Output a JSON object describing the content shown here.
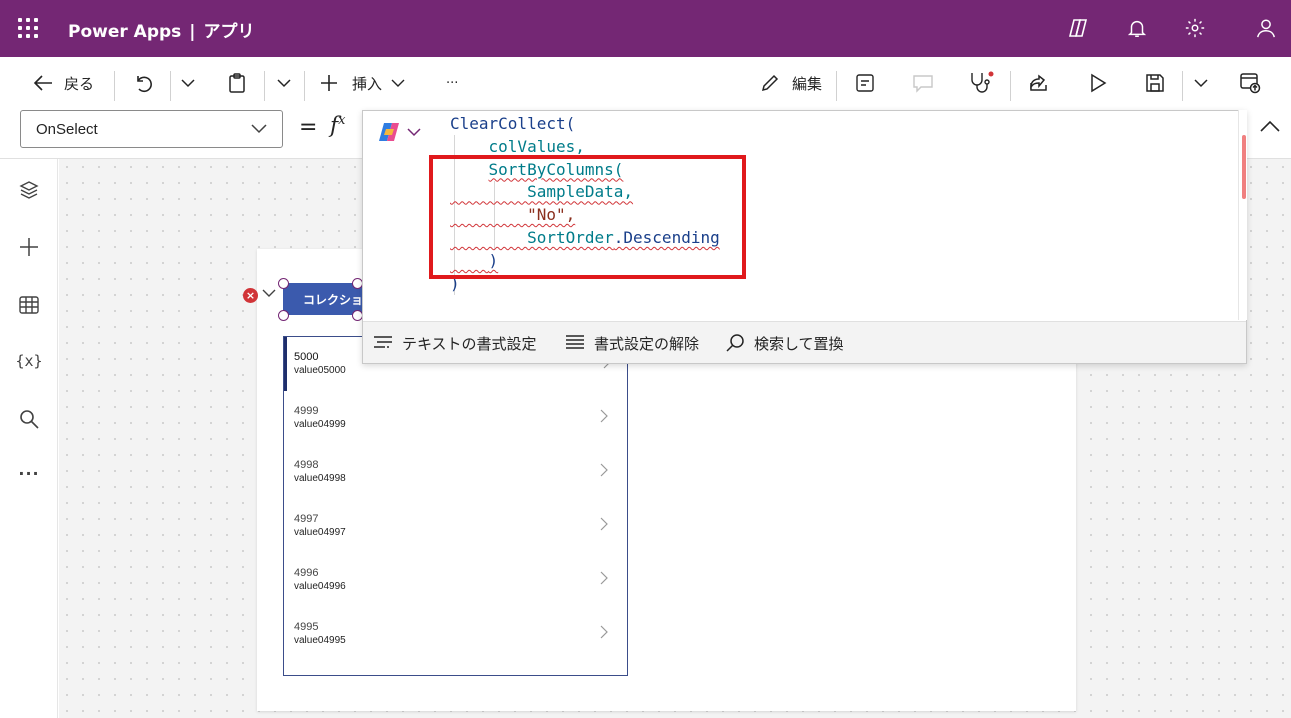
{
  "header": {
    "app_name": "Power Apps",
    "separator": "|",
    "section": "アプリ"
  },
  "commandbar": {
    "back_label": "戻る",
    "insert_label": "挿入",
    "more_label": "···",
    "edit_label": "編集"
  },
  "formula_bar": {
    "property": "OnSelect",
    "equals": "=",
    "fx": "f",
    "fx_sup": "x"
  },
  "editor": {
    "code_lines": [
      "ClearCollect(",
      "colValues,",
      "SortByColumns(",
      "SampleData,",
      "\"No\",",
      "SortOrder",
      ".Descending",
      ")",
      ")"
    ],
    "footer": {
      "format_text": "テキストの書式設定",
      "remove_format": "書式設定の解除",
      "find_replace": "検索して置換"
    }
  },
  "canvas": {
    "button_label": "コレクション",
    "error_mark": "×",
    "gallery_items": [
      {
        "title": "5000",
        "subtitle": "value05000"
      },
      {
        "title": "4999",
        "subtitle": "value04999"
      },
      {
        "title": "4998",
        "subtitle": "value04998"
      },
      {
        "title": "4997",
        "subtitle": "value04997"
      },
      {
        "title": "4996",
        "subtitle": "value04996"
      },
      {
        "title": "4995",
        "subtitle": "value04995"
      }
    ]
  },
  "colors": {
    "header_bg": "#742774",
    "button_bg": "#3b5aad",
    "highlight_box": "#e0191c",
    "error": "#d13438"
  },
  "icons": [
    "waffle-icon",
    "copilot-icon",
    "bell-icon",
    "settings-icon",
    "person-icon",
    "back-arrow-icon",
    "undo-icon",
    "paste-icon",
    "plus-icon",
    "edit-pencil-icon",
    "comment-icon",
    "stethoscope-icon",
    "share-icon",
    "play-icon",
    "save-icon",
    "publish-icon",
    "layers-icon",
    "table-icon",
    "variables-icon",
    "search-icon"
  ]
}
